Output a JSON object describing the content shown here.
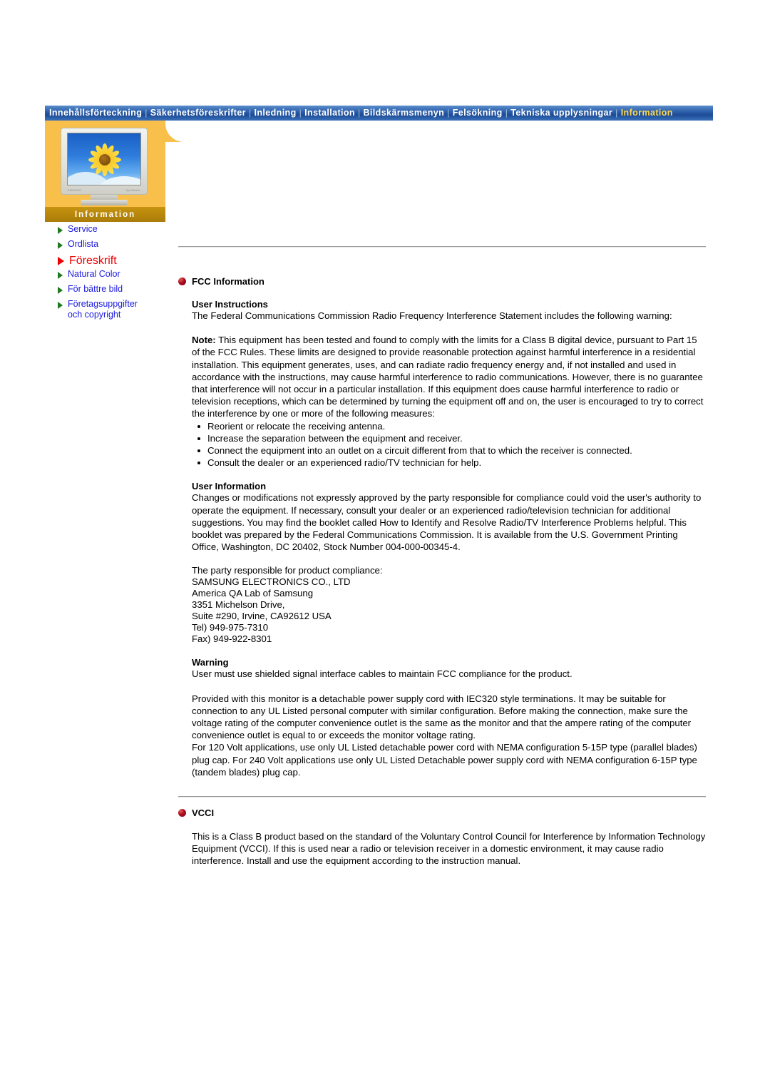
{
  "topnav": {
    "items": [
      {
        "label": "Innehållsförteckning",
        "active": false
      },
      {
        "label": "Säkerhetsföreskrifter",
        "active": false
      },
      {
        "label": "Inledning",
        "active": false
      },
      {
        "label": "Installation",
        "active": false
      },
      {
        "label": "Bildskärmsmenyn",
        "active": false
      },
      {
        "label": "Felsökning",
        "active": false
      },
      {
        "label": "Tekniska upplysningar",
        "active": false
      },
      {
        "label": "Information",
        "active": true
      }
    ],
    "separator": "|",
    "active_color": "#ffd84d",
    "bar_color": "#1d4b96"
  },
  "sidebar": {
    "banner_label": "Information",
    "banner_color": "#b8870c",
    "panel_color": "#f8c04a",
    "monitor": {
      "brand_label": "SAMSUNG",
      "model_label": "SyncMaster"
    },
    "items": [
      {
        "label": "Service",
        "active": false
      },
      {
        "label": "Ordlista",
        "active": false
      },
      {
        "label": "Föreskrift",
        "active": true
      },
      {
        "label": "Natural Color",
        "active": false
      },
      {
        "label": "För bättre bild",
        "active": false
      },
      {
        "label": "Företagsuppgifter",
        "label_cont": "och copyright",
        "active": false
      }
    ],
    "link_color": "#1a1ae0",
    "active_color": "#ee0000"
  },
  "content": {
    "fcc": {
      "title": "FCC Information",
      "user_instructions_head": "User Instructions",
      "intro": "The Federal Communications Commission Radio Frequency Interference Statement includes the following warning:",
      "note_label": "Note:",
      "note_body": " This equipment has been tested and found to comply with the limits for a Class B digital device, pursuant to Part 15 of the FCC Rules. These limits are designed to provide reasonable protection against harmful interference in a residential installation. This equipment generates, uses, and can radiate radio frequency energy and, if not installed and used in accordance with the instructions, may cause harmful interference to radio communications. However, there is no guarantee that interference will not occur in a particular installation. If this equipment does cause harmful interference to radio or television receptions, which can be determined by turning the equipment off and on, the user is encouraged to try to correct the interference by one or more of the following measures:",
      "measures": [
        "Reorient or relocate the receiving antenna.",
        "Increase the separation between the equipment and receiver.",
        "Connect the equipment into an outlet on a circuit different from that to which the receiver is connected.",
        "Consult the dealer or an experienced radio/TV technician for help."
      ],
      "user_information_head": "User Information",
      "user_information_body": "Changes or modifications not expressly approved by the party responsible for compliance could void the user's authority to operate the equipment. If necessary, consult your dealer or an experienced radio/television technician for additional suggestions. You may find the booklet called How to Identify and Resolve Radio/TV Interference Problems helpful. This booklet was prepared by the Federal Communications Commission. It is available from the U.S. Government Printing Office, Washington, DC 20402, Stock Number 004-000-00345-4.",
      "responsible_party_label": "The party responsible for product compliance:",
      "address": [
        "SAMSUNG ELECTRONICS CO., LTD",
        "America QA Lab of Samsung",
        "3351 Michelson Drive,",
        "Suite #290, Irvine, CA92612 USA",
        "Tel) 949-975-7310",
        "Fax) 949-922-8301"
      ],
      "warning_head": "Warning",
      "warning_body": "User must use shielded signal interface cables to maintain FCC compliance for the product.",
      "power_cord_body": "Provided with this monitor is a detachable power supply cord with IEC320 style terminations. It may be suitable for connection to any UL Listed personal computer with similar configuration. Before making the connection, make sure the voltage rating of the computer convenience outlet is the same as the monitor and that the ampere rating of the computer convenience outlet is equal to or exceeds the monitor voltage rating.",
      "nema_body": "For 120 Volt applications, use only UL Listed detachable power cord with NEMA configuration 5-15P type (parallel blades) plug cap. For 240 Volt applications use only UL Listed Detachable power supply cord with NEMA configuration 6-15P type (tandem blades) plug cap."
    },
    "vcci": {
      "title": "VCCI",
      "body": "This is a Class B product based on the standard of the Voluntary Control Council for Interference by Information Technology Equipment (VCCI). If this is used near a radio or television receiver in a domestic environment, it may cause radio interference. Install and use the equipment according to the instruction manual."
    }
  }
}
